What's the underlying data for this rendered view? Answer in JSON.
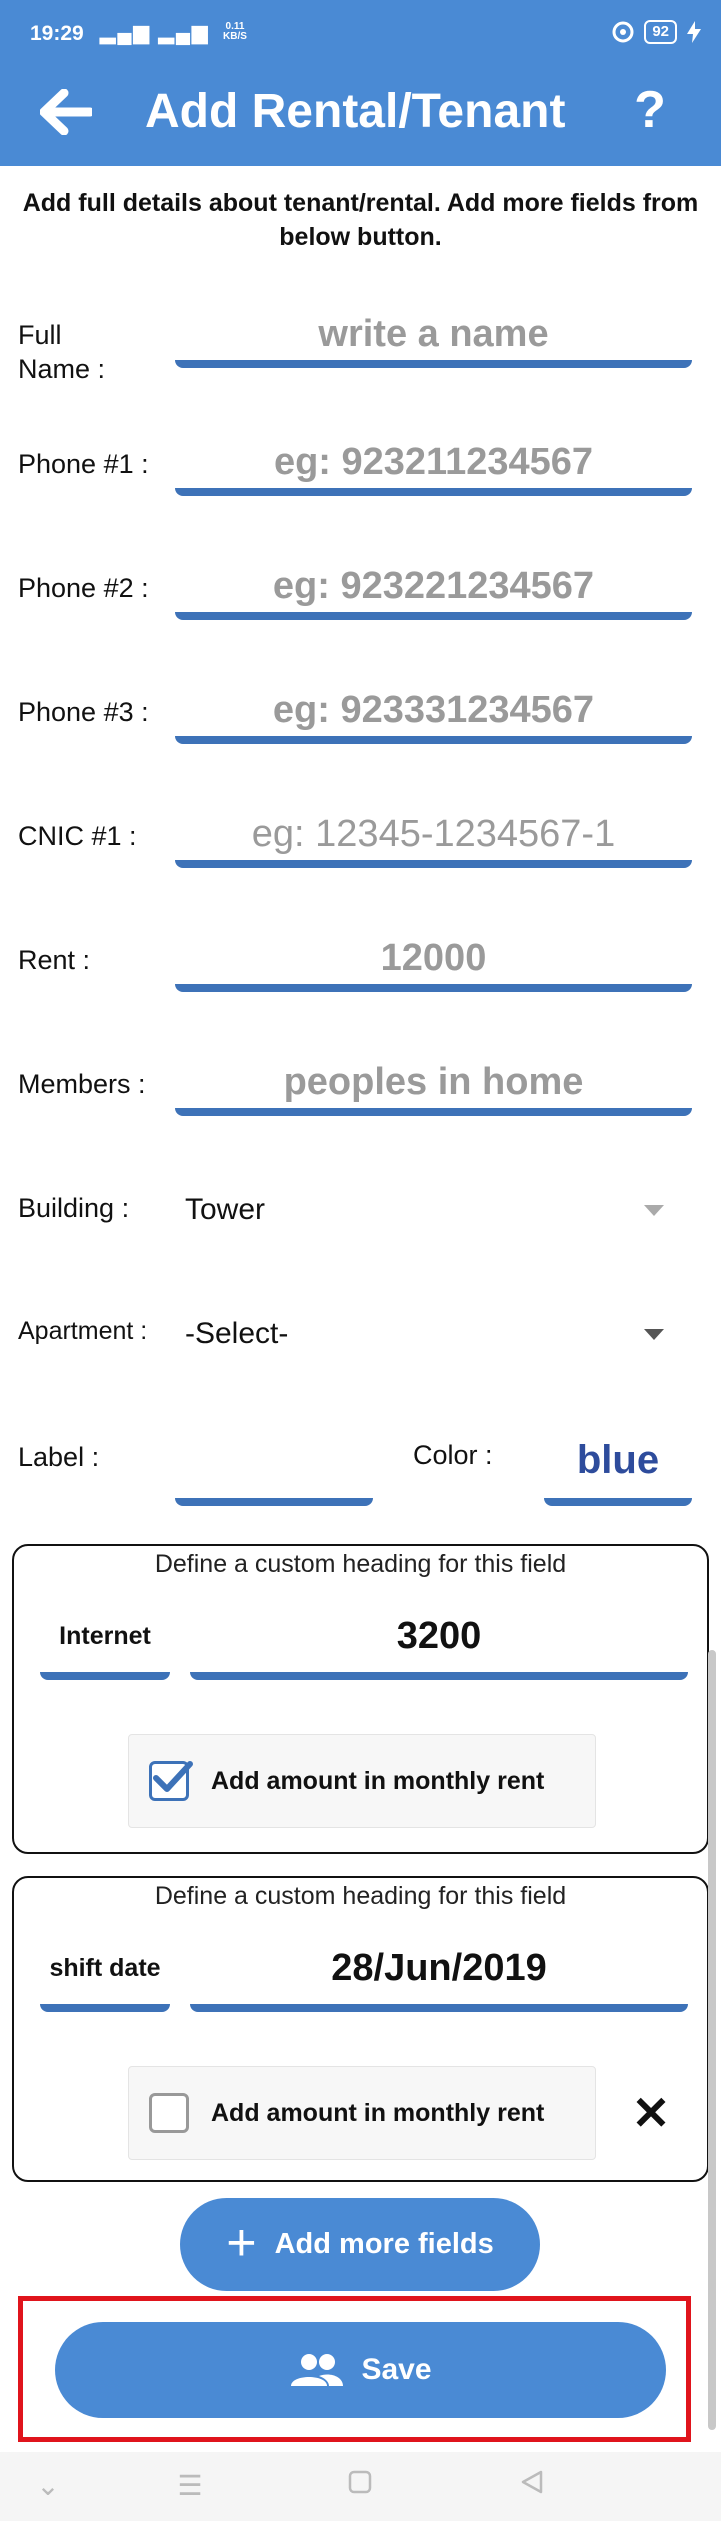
{
  "status_bar": {
    "time": "19:29",
    "signal": "▂▄▆ ▂▄▆",
    "speed_value": "0.11",
    "speed_unit": "KB/S",
    "battery": "92"
  },
  "header": {
    "title": "Add Rental/Tenant",
    "help": "?"
  },
  "intro": "Add full details about tenant/rental. Add more fields from below button.",
  "fields": {
    "full_name": {
      "label": "Full Name :",
      "placeholder": "write a name"
    },
    "phone1": {
      "label": "Phone #1 :",
      "placeholder": "eg: 923211234567"
    },
    "phone2": {
      "label": "Phone #2 :",
      "placeholder": "eg: 923221234567"
    },
    "phone3": {
      "label": "Phone #3 :",
      "placeholder": "eg: 923331234567"
    },
    "cnic1": {
      "label": "CNIC #1 :",
      "placeholder": "eg: 12345-1234567-1"
    },
    "rent": {
      "label": "Rent :",
      "placeholder": "12000"
    },
    "members": {
      "label": "Members :",
      "placeholder": "peoples in home"
    }
  },
  "building": {
    "label": "Building :",
    "selected": "Tower"
  },
  "apartment": {
    "label": "Apartment :",
    "selected": "-Select-"
  },
  "label_field": {
    "label": "Label :"
  },
  "color_field": {
    "label": "Color :",
    "value": "blue"
  },
  "custom_fields": [
    {
      "heading": "Define a custom heading for this field",
      "key": "Internet",
      "value": "3200",
      "checkbox_label": "Add amount in monthly rent",
      "checked": true
    },
    {
      "heading": "Define a custom heading for this field",
      "key": "shift date",
      "value": "28/Jun/2019",
      "checkbox_label": "Add amount in monthly rent",
      "checked": false,
      "remove": "✕"
    }
  ],
  "buttons": {
    "add_more": "Add more fields",
    "save": "Save"
  },
  "colors": {
    "primary": "#4a8ad4",
    "underline": "#3d72b8",
    "highlight": "#e0141c",
    "color_value": "#2e4c9c"
  },
  "icons": [
    "back-arrow-icon",
    "help-icon",
    "plus-icon",
    "people-icon",
    "close-icon",
    "checkbox-icon"
  ]
}
